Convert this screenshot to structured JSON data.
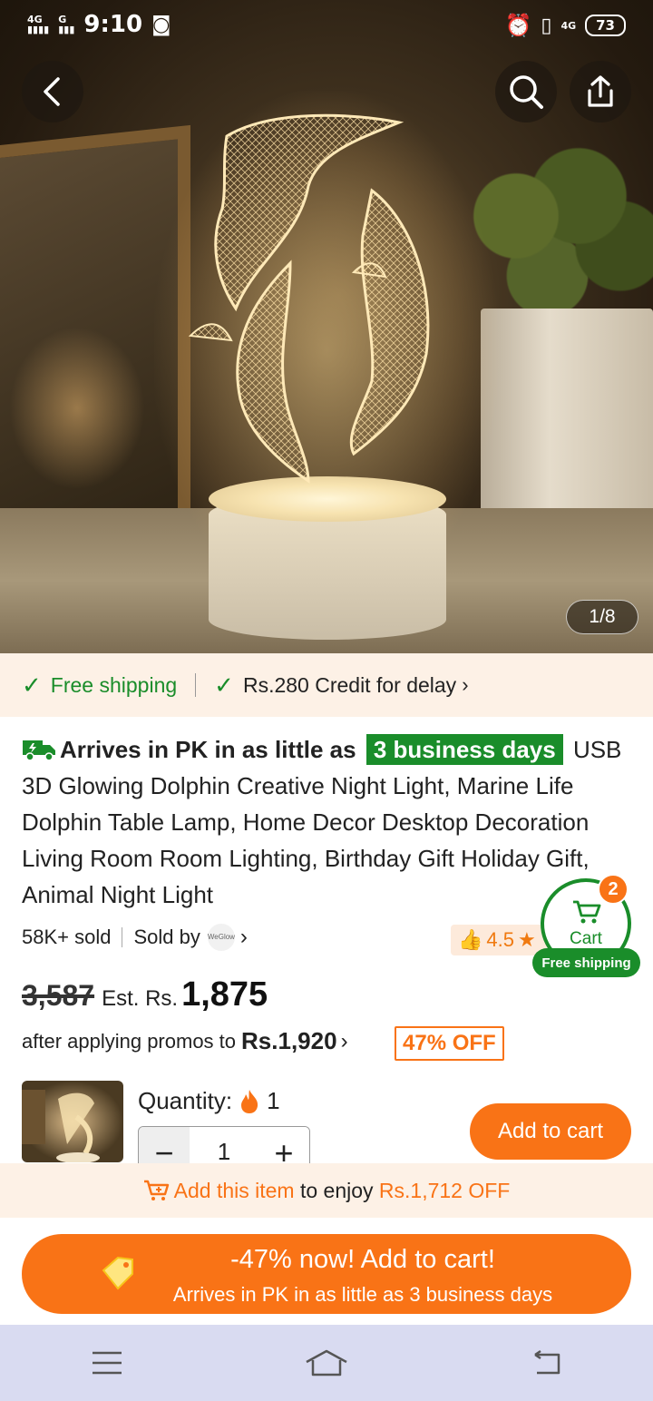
{
  "status_bar": {
    "time": "9:10",
    "network_left": "4G",
    "network_left2": "G",
    "network_right": "4G",
    "battery": "73"
  },
  "gallery": {
    "counter": "1/8"
  },
  "shipping": {
    "free_shipping": "Free shipping",
    "credit": "Rs.280 Credit for delay"
  },
  "product": {
    "arrive_text": "Arrives in PK in as little as",
    "arrive_days": "3 business days",
    "title": "USB 3D Glowing Dolphin Creative Night Light, Marine Life Dolphin Table Lamp, Home Decor Desktop Decoration Living Room Room Lighting, Birthday Gift Holiday Gift, Animal Night Light",
    "sold": "58K+ sold",
    "sold_by": "Sold by",
    "seller_logo_text": "WeGlow",
    "rating": "4.5"
  },
  "cart": {
    "label": "Cart",
    "count": "2",
    "free_shipping": "Free shipping"
  },
  "price": {
    "original": "3,587",
    "est_label": "Est. Rs.",
    "current": "1,875",
    "promo_text": "after applying promos to",
    "promo_price": "Rs.1,920",
    "off_badge": "47% OFF"
  },
  "quantity": {
    "label": "Quantity:",
    "stock": "1",
    "value": "1",
    "minus": "−",
    "plus": "+"
  },
  "add_to_cart": "Add to cart",
  "promo_bar": {
    "link": "Add this item",
    "middle": " to enjoy ",
    "amount": "Rs.1,712 OFF"
  },
  "cta": {
    "line1": "-47% now! Add to cart!",
    "line2": "Arrives in PK in as little as 3 business days"
  },
  "colors": {
    "accent": "#f97316",
    "green": "#1a8d2a"
  }
}
